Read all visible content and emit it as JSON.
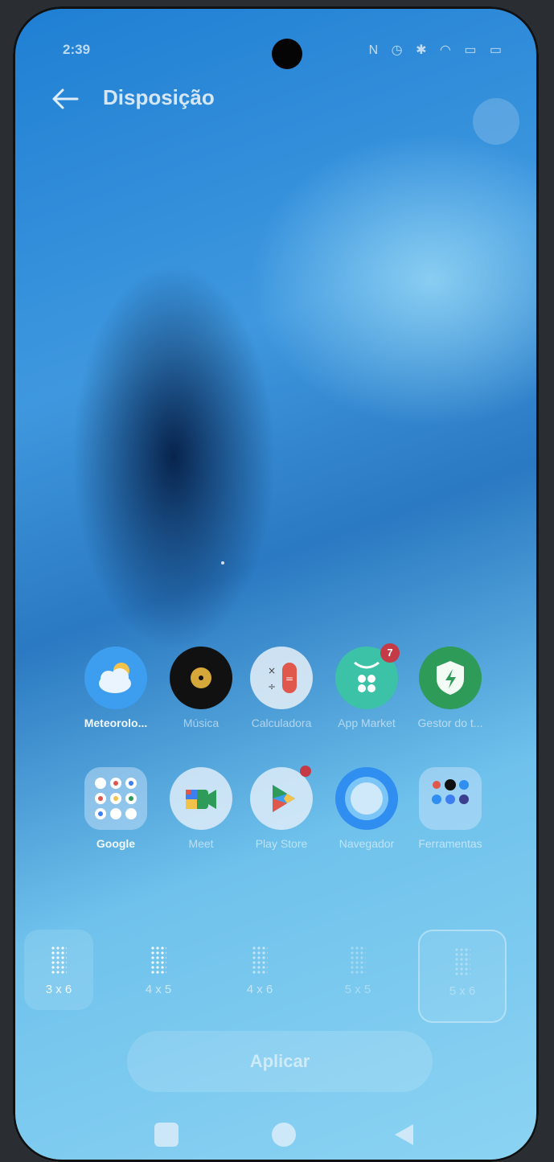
{
  "status_bar": {
    "time": "2:39",
    "icons": "N ◷ ✱ ◠ ▭ ▭"
  },
  "header": {
    "title": "Disposição"
  },
  "apps": [
    {
      "name": "weather-app",
      "label": "Meteorolo...",
      "icon": "cloud-sun-icon"
    },
    {
      "name": "music-app",
      "label": "Música",
      "icon": "vinyl-icon"
    },
    {
      "name": "calculator-app",
      "label": "Calculadora",
      "icon": "calculator-icon"
    },
    {
      "name": "app-market-app",
      "label": "App Market",
      "icon": "market-icon",
      "badge": "7"
    },
    {
      "name": "device-manager-app",
      "label": "Gestor do t...",
      "icon": "shield-bolt-icon"
    },
    {
      "name": "google-folder",
      "label": "Google",
      "icon": "google-folder-icon"
    },
    {
      "name": "meet-app",
      "label": "Meet",
      "icon": "meet-icon"
    },
    {
      "name": "play-store-app",
      "label": "Play Store",
      "icon": "play-store-icon"
    },
    {
      "name": "browser-app",
      "label": "Navegador",
      "icon": "browser-icon"
    },
    {
      "name": "tools-folder",
      "label": "Ferramentas",
      "icon": "tools-folder-icon"
    }
  ],
  "grid_options": [
    {
      "label": "3 x 6"
    },
    {
      "label": "4 x 5"
    },
    {
      "label": "4 x 6"
    },
    {
      "label": "5 x 5"
    },
    {
      "label": "5 x 6"
    }
  ],
  "apply_button": {
    "label": "Aplicar"
  },
  "colors": {
    "badge": "#c43a47",
    "wallpaper_blue": "#2a79c2",
    "accent_green": "#2f9b58"
  }
}
